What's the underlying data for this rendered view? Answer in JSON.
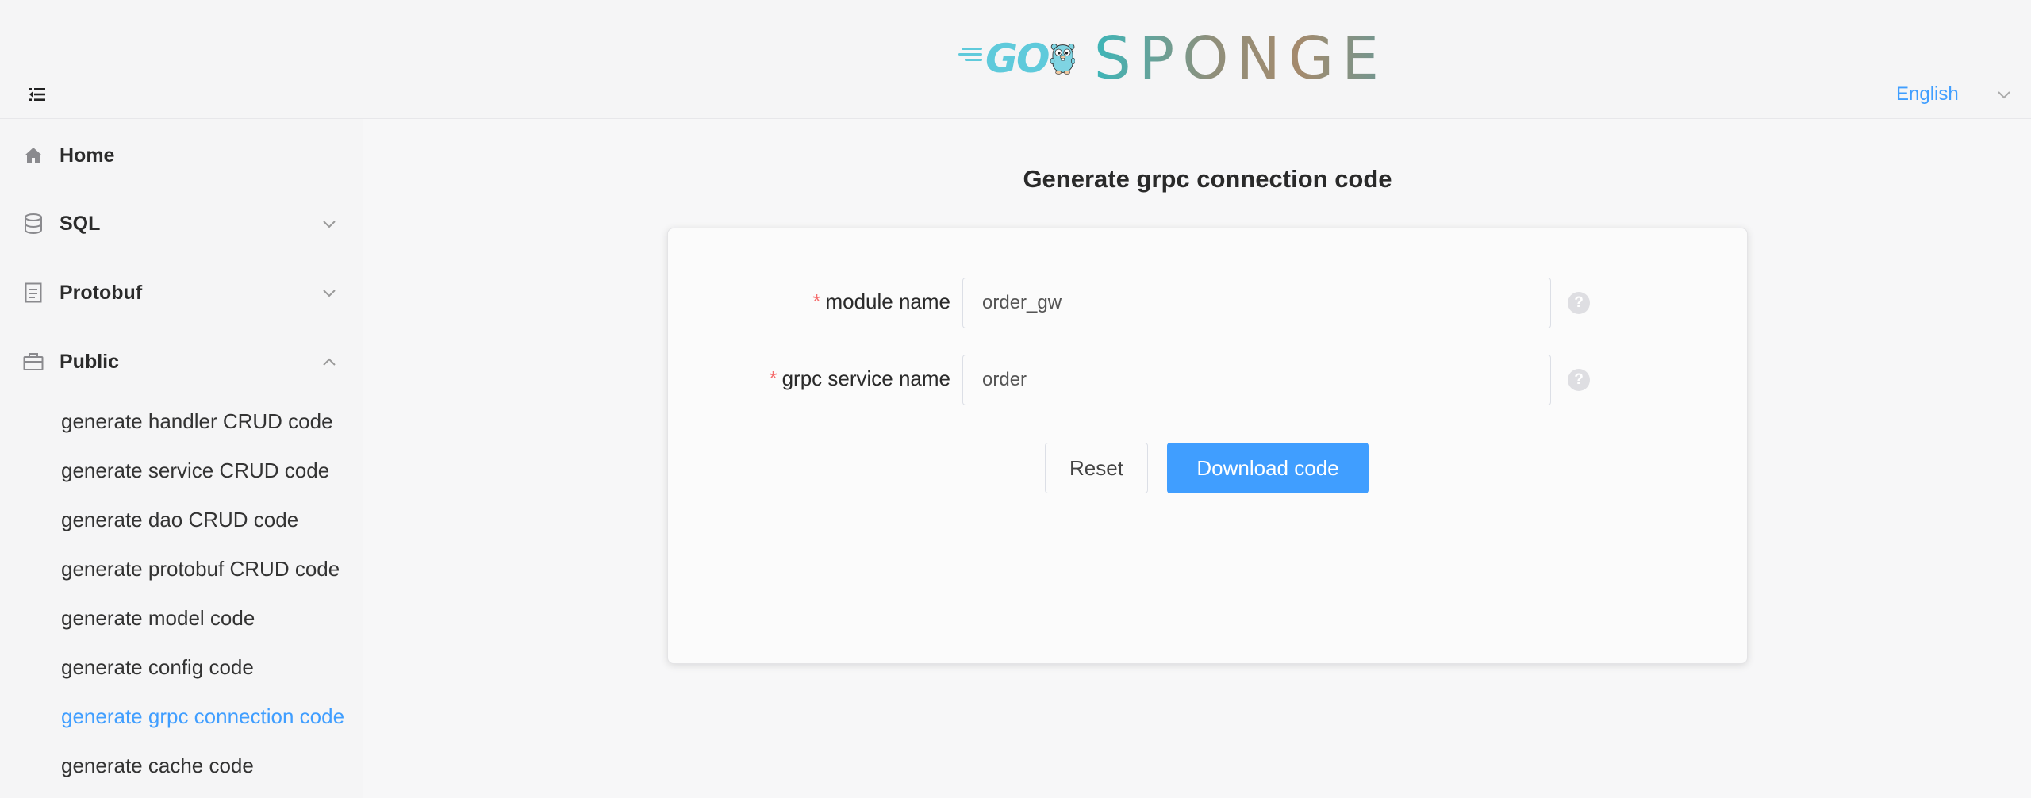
{
  "header": {
    "logo": {
      "go_text": "GO",
      "sponge_text": "SPONGE"
    },
    "language": {
      "selected": "English"
    },
    "icons": {
      "menu_toggle": "menu-fold-icon",
      "language_caret": "chevron-down-icon"
    }
  },
  "sidebar": {
    "items": [
      {
        "label": "Home",
        "icon": "home-icon",
        "expandable": false
      },
      {
        "label": "SQL",
        "icon": "database-icon",
        "expandable": true,
        "expanded": false
      },
      {
        "label": "Protobuf",
        "icon": "document-icon",
        "expandable": true,
        "expanded": false
      },
      {
        "label": "Public",
        "icon": "briefcase-icon",
        "expandable": true,
        "expanded": true
      }
    ],
    "public_sub_items": [
      {
        "label": "generate handler CRUD code",
        "active": false
      },
      {
        "label": "generate service CRUD code",
        "active": false
      },
      {
        "label": "generate dao CRUD code",
        "active": false
      },
      {
        "label": "generate protobuf CRUD code",
        "active": false
      },
      {
        "label": "generate model code",
        "active": false
      },
      {
        "label": "generate config code",
        "active": false
      },
      {
        "label": "generate grpc connection code",
        "active": true
      },
      {
        "label": "generate cache code",
        "active": false
      }
    ]
  },
  "main": {
    "title": "Generate grpc connection code",
    "form": {
      "fields": [
        {
          "label": "module name",
          "required": true,
          "value": "order_gw",
          "help_icon": "question-circle-icon"
        },
        {
          "label": "grpc service name",
          "required": true,
          "value": "order",
          "help_icon": "question-circle-icon"
        }
      ],
      "reset_label": "Reset",
      "download_label": "Download code"
    }
  },
  "colors": {
    "accent": "#409eff",
    "required_mark": "#f56c6c",
    "logo_go": "#5fcadb"
  }
}
